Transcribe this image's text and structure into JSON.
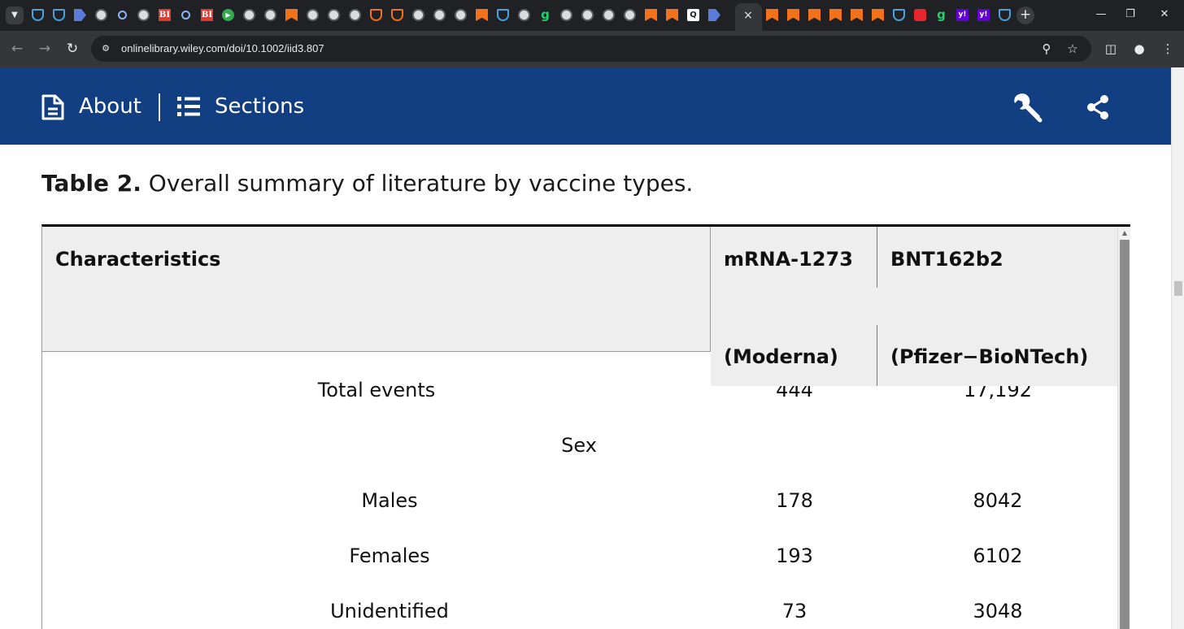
{
  "browser": {
    "tab_count_visible": 49,
    "active_tab_close": "×",
    "new_tab": "+",
    "window_controls": [
      "minimize",
      "restore",
      "close"
    ],
    "address": {
      "url": "onlinelibrary.wiley.com/doi/10.1002/iid3.807"
    },
    "icons": [
      "back-icon",
      "forward-icon",
      "reload-icon",
      "site-info-icon",
      "zoom-icon",
      "bookmark-star-icon",
      "side-panel-icon",
      "profile-icon",
      "menu-icon"
    ]
  },
  "toolbar": {
    "about_label": "About",
    "sections_label": "Sections",
    "bg_color": "#123e82"
  },
  "caption": {
    "label": "Table 2.",
    "text": " Overall summary of literature by vaccine types."
  },
  "table": {
    "headers": {
      "characteristics": "Characteristics",
      "col1_name": "mRNA-1273",
      "col1_sub": "(Moderna)",
      "col2_name": "BNT162b2",
      "col2_sub": "(Pfizer−BioNTech)"
    },
    "rows": [
      {
        "label": "Total events",
        "c1": "444",
        "c2": "17,192"
      },
      {
        "label": "Sex",
        "c1": "",
        "c2": ""
      },
      {
        "label": "Males",
        "c1": "178",
        "c2": "8042"
      },
      {
        "label": "Females",
        "c1": "193",
        "c2": "6102"
      },
      {
        "label": "Unidentified",
        "c1": "73",
        "c2": "3048"
      }
    ]
  }
}
